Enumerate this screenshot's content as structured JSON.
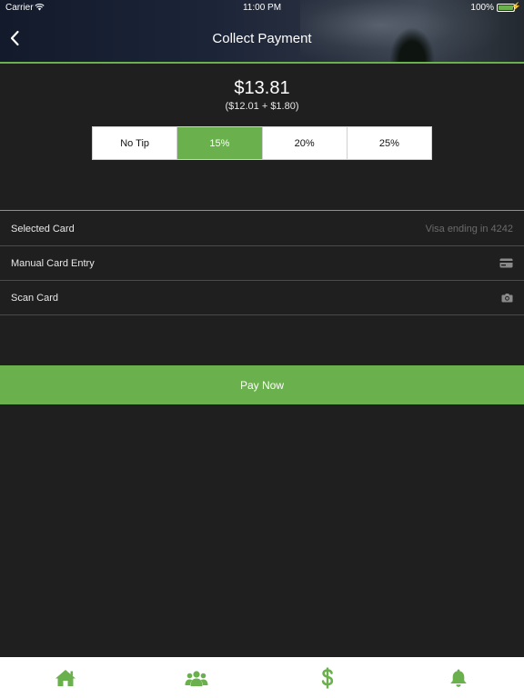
{
  "status_bar": {
    "carrier": "Carrier",
    "time": "11:00 PM",
    "battery": "100%"
  },
  "nav": {
    "title": "Collect Payment"
  },
  "payment": {
    "total": "$13.81",
    "breakdown": "($12.01 + $1.80)"
  },
  "tips": {
    "options": [
      "No Tip",
      "15%",
      "20%",
      "25%"
    ],
    "selected": "15%"
  },
  "card_rows": {
    "selected_label": "Selected Card",
    "selected_value": "Visa ending in 4242",
    "manual_label": "Manual Card Entry",
    "scan_label": "Scan Card"
  },
  "pay_button": {
    "label": "Pay Now"
  },
  "tab_bar": {
    "items": [
      "home-icon",
      "group-icon",
      "dollar-icon",
      "bell-icon"
    ],
    "active_color": "#6ab04c"
  },
  "colors": {
    "accent": "#6ab04c",
    "background": "#1f1f1f"
  }
}
